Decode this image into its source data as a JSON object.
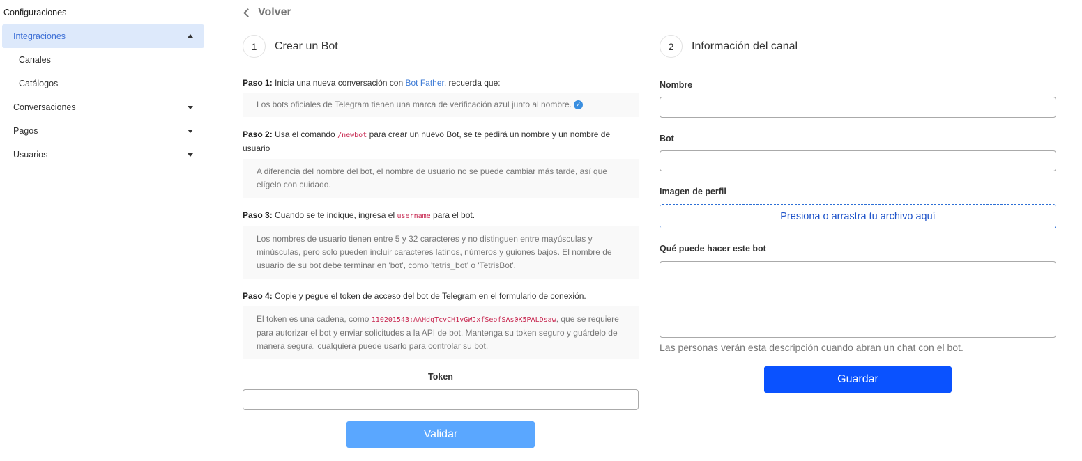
{
  "sidebar": {
    "title": "Configuraciones",
    "items": [
      {
        "label": "Integraciones"
      },
      {
        "label": "Canales"
      },
      {
        "label": "Catálogos"
      },
      {
        "label": "Conversaciones"
      },
      {
        "label": "Pagos"
      },
      {
        "label": "Usuarios"
      }
    ]
  },
  "back_label": "Volver",
  "left": {
    "step_number": "1",
    "title": "Crear un Bot",
    "steps": [
      {
        "prefix": "Paso 1:",
        "text_a": " Inicia una nueva conversación con ",
        "link": "Bot Father",
        "text_b": ", recuerda que:",
        "note": "Los bots oficiales de Telegram tienen una marca de verificación azul junto al nombre."
      },
      {
        "prefix": "Paso 2:",
        "text_a": " Usa el comando ",
        "code": "/newbot",
        "text_b": " para crear un nuevo Bot, se te pedirá un nombre y un nombre de usuario",
        "note": "A diferencia del nombre del bot, el nombre de usuario no se puede cambiar más tarde, así que elígelo con cuidado."
      },
      {
        "prefix": "Paso 3:",
        "text_a": " Cuando se te indique, ingresa el ",
        "code": "username",
        "text_b": " para el bot.",
        "note": "Los nombres de usuario tienen entre 5 y 32 caracteres y no distinguen entre mayúsculas y minúsculas, pero solo pueden incluir caracteres latinos, números y guiones bajos. El nombre de usuario de su bot debe terminar en 'bot', como 'tetris_bot' o 'TetrisBot'."
      },
      {
        "prefix": "Paso 4:",
        "text_a": " Copie y pegue el token de acceso del bot de Telegram en el formulario de conexión.",
        "note_a": "El token es una cadena, como ",
        "note_code": "110201543:AAHdqTcvCH1vGWJxfSeofSAs0K5PALDsaw",
        "note_b": ", que se requiere para autorizar el bot y enviar solicitudes a la API de bot. Mantenga su token seguro y guárdelo de manera segura, cualquiera puede usarlo para controlar su bot."
      }
    ],
    "token_label": "Token",
    "token_value": "",
    "validate_label": "Validar"
  },
  "right": {
    "step_number": "2",
    "title": "Información del canal",
    "name_label": "Nombre",
    "name_value": "",
    "bot_label": "Bot",
    "bot_value": "",
    "image_label": "Imagen de perfil",
    "dropzone_label": "Presiona o arrastra tu archivo aquí",
    "desc_label": "Qué puede hacer este bot",
    "desc_value": "",
    "hint": "Las personas verán esta descripción cuando abran un chat con el bot.",
    "save_label": "Guardar"
  },
  "colors": {
    "active_bg": "#dde9fb",
    "link": "#3d7bd6",
    "validate_btn": "#5aa7ff",
    "save_btn": "#0a52ff"
  }
}
